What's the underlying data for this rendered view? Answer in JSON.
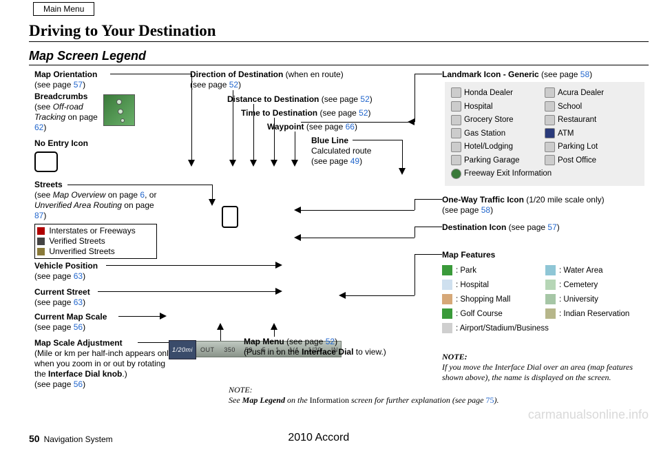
{
  "header": {
    "main_menu": "Main Menu",
    "title": "Driving to Your Destination",
    "subtitle": "Map Screen Legend"
  },
  "left": {
    "map_orientation": {
      "label": "Map Orientation",
      "see": "(see page ",
      "page": "57",
      "close": ")"
    },
    "breadcrumbs": {
      "label": "Breadcrumbs",
      "line1": "(see ",
      "ital": "Off-road Tracking",
      "line2": " on page ",
      "page": "62",
      "close": ")"
    },
    "no_entry": "No Entry Icon",
    "streets": {
      "label": "Streets",
      "line1": "(see ",
      "ital1": "Map Overview",
      "line2": " on page ",
      "p1": "6",
      "line3": ", or ",
      "ital2": "Unverified Area Routing",
      "line4": " on page ",
      "p2": "87",
      "close": ")",
      "i_label": " Interstates or Freeways",
      "v_label": " Verified Streets",
      "u_label": " Unverified Streets"
    },
    "vehicle_position": {
      "label": "Vehicle Position",
      "see": "(see page ",
      "page": "63",
      "close": ")"
    },
    "current_street": {
      "label": "Current Street",
      "see": "(see page ",
      "page": "63",
      "close": ")"
    },
    "current_scale": {
      "label": "Current Map Scale",
      "see": "(see page ",
      "page": "56",
      "close": ")"
    },
    "scale_adjust": {
      "label": "Map Scale Adjustment",
      "body1": "(Mile or km per half-inch appears only when you zoom in or out by rotating the ",
      "bold": "Interface Dial knob",
      "body2": ".)",
      "see": "(see page ",
      "page": "56",
      "close": ")"
    }
  },
  "mid": {
    "direction": {
      "label": "Direction of Destination",
      "suffix": " (when en route)",
      "see": "(see page ",
      "page": "52",
      "close": ")"
    },
    "distance": {
      "label": "Distance to Destination",
      "see": " (see page ",
      "page": "52",
      "close": ")"
    },
    "time": {
      "label": "Time to Destination",
      "see": " (see page ",
      "page": "52",
      "close": ")"
    },
    "waypoint": {
      "label": "Waypoint",
      "see": " (see page ",
      "page": "66",
      "close": ")"
    },
    "blue_line": {
      "label": "Blue Line",
      "body": "Calculated route",
      "see": "(see page ",
      "page": "49",
      "close": ")"
    },
    "map_menu": {
      "label": "Map Menu",
      "see": " (see page ",
      "page": "52",
      "close": ")",
      "body1": "(Push in on the ",
      "bold": "Interface Dial",
      "body2": " to view.)"
    }
  },
  "right": {
    "landmark_header": {
      "label": "Landmark Icon - Generic",
      "see": " (see page ",
      "page": "58",
      "close": ")"
    },
    "landmarks": {
      "honda": "Honda Dealer",
      "acura": "Acura Dealer",
      "hospital": "Hospital",
      "school": "School",
      "grocery": "Grocery Store",
      "restaurant": "Restaurant",
      "gas": "Gas Station",
      "atm": "ATM",
      "hotel": "Hotel/Lodging",
      "parking_lot": "Parking Lot",
      "parking_garage": "Parking Garage",
      "post": "Post Office",
      "freeway": "Freeway Exit Information"
    },
    "one_way": {
      "label": "One-Way Traffic Icon",
      "suffix": " (1/20 mile scale only)",
      "see": "(see page ",
      "page": "58",
      "close": ")"
    },
    "dest_icon": {
      "label": "Destination Icon",
      "see": " (see page ",
      "page": "57",
      "close": ")"
    },
    "map_features": {
      "header": "Map Features",
      "park": ": Park",
      "water": ": Water Area",
      "hospital": ": Hospital",
      "cemetery": ": Cemetery",
      "shopping": ": Shopping Mall",
      "university": ": University",
      "golf": ": Golf Course",
      "indian": ": Indian Reservation",
      "airport": ": Airport/Stadium/Business"
    },
    "note_label": "NOTE:",
    "note_body": "If you move the Interface Dial over an area (map features shown above), the name is displayed on the screen."
  },
  "scale_bar": {
    "tab": "1/20mi",
    "vals": [
      "OUT",
      "350",
      "50",
      "5",
      "1",
      "1/4",
      "1/20",
      "IN"
    ]
  },
  "bottom_note": {
    "label": "NOTE:",
    "pre": "See ",
    "bold": "Map Legend",
    "mid": " on the ",
    "screen": "Information",
    "post": " screen for further explanation (see page ",
    "page": "75",
    "end": ")."
  },
  "footer": {
    "page_num": "50",
    "section": "Navigation System",
    "model": "2010 Accord"
  },
  "watermark": "carmanualsonline.info"
}
